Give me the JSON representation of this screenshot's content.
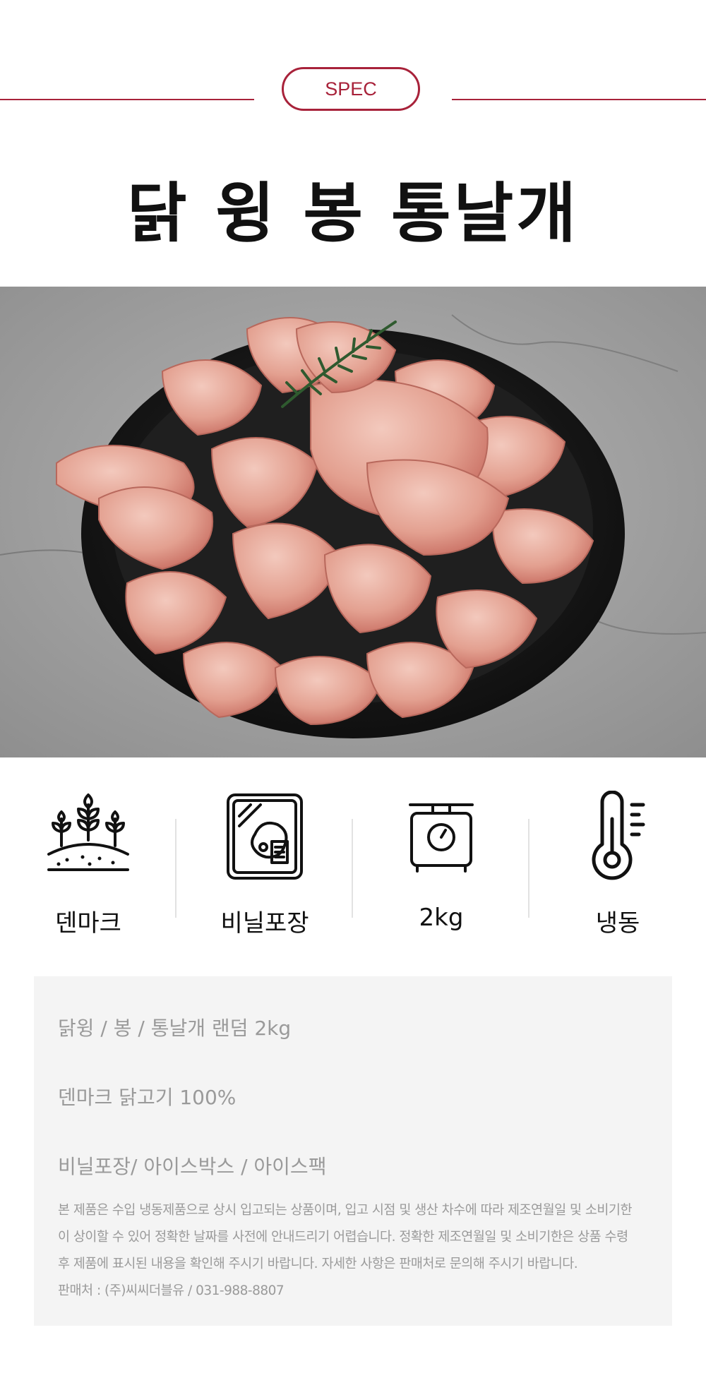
{
  "header": {
    "spec_label": "SPEC",
    "title": "닭 윙 봉 통날개"
  },
  "photo": {
    "subject": "raw chicken wings on black plate with rosemary"
  },
  "specs": [
    {
      "icon": "wheat-field-icon",
      "label": "덴마크"
    },
    {
      "icon": "vinyl-package-icon",
      "label": "비닐포장"
    },
    {
      "icon": "scale-icon",
      "label": "2kg"
    },
    {
      "icon": "thermometer-icon",
      "label": "냉동"
    }
  ],
  "info": {
    "product": "닭윙 / 봉  / 통날개 랜덤  2kg",
    "origin": "덴마크 닭고기 100%",
    "packaging": "비닐포장/ 아이스박스 / 아이스팩",
    "notice": [
      "본 제품은 수입 냉동제품으로 상시 입고되는 상품이며, 입고 시점 및 생산 차수에 따라 제조연월일 및 소비기한",
      "이 상이할 수 있어 정확한 날짜를 사전에 안내드리기 어렵습니다. 정확한 제조연월일 및 소비기한은 상품 수령",
      " 후 제품에 표시된 내용을 확인해 주시기 바랍니다. 자세한 사항은 판매처로 문의해 주시기 바랍니다.",
      "판매처 : (주)씨씨더블유 / 031-988-8807"
    ]
  },
  "colors": {
    "accent": "#a8223a",
    "muted_text": "#9a9a9a",
    "panel_bg": "#f4f4f4"
  }
}
